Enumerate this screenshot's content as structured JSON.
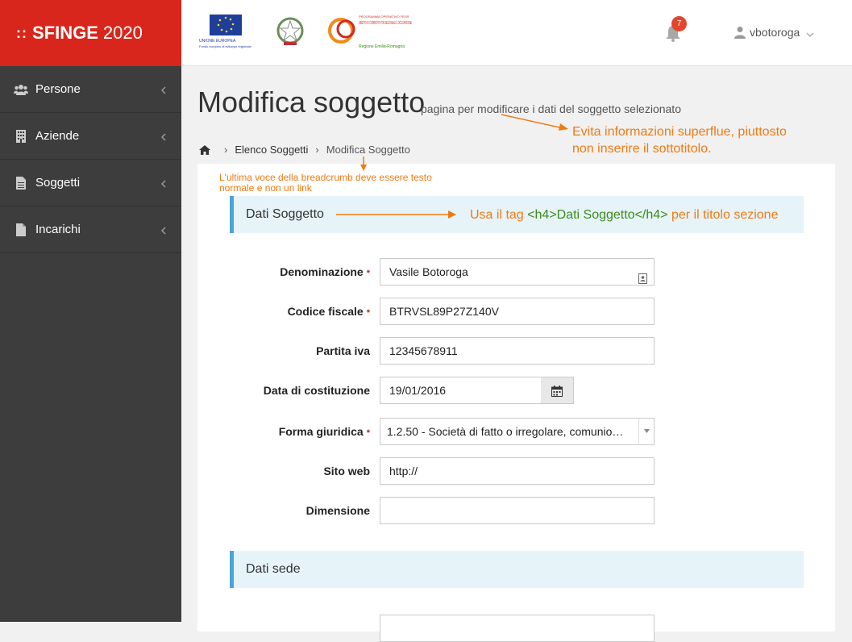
{
  "brand": {
    "prefix": "::",
    "name": "SFINGE",
    "year": "2020"
  },
  "logos": [
    {
      "icon": "eu-flag-logo",
      "lines": [
        "UNIONE EUROPEA",
        "Fondo europeo di sviluppo regionale"
      ]
    },
    {
      "icon": "italian-republic-emblem-logo"
    },
    {
      "icon": "por-logo",
      "lines": [
        "PROGRAMMA OPERATIVO FESR",
        "OBIETTIVO COMPETITIVITÀ REGIONALE E OCCUPAZIONE",
        "Regione Emilia-Romagna"
      ]
    }
  ],
  "header": {
    "notification_count": "7",
    "username": "vbotoroga"
  },
  "sidebar": {
    "items": [
      {
        "label": "Persone",
        "icon": "users-icon"
      },
      {
        "label": "Aziende",
        "icon": "building-icon"
      },
      {
        "label": "Soggetti",
        "icon": "document-icon"
      },
      {
        "label": "Incarichi",
        "icon": "document-outline-icon"
      }
    ]
  },
  "page": {
    "title": "Modifica soggetto",
    "subtitle": "pagina per modificare i dati del soggetto selezionato",
    "breadcrumb": [
      "Elenco Soggetti",
      "Modifica Soggetto"
    ]
  },
  "annotations": {
    "subtitle_note": [
      "Evita informazioni superflue, piuttosto",
      "non inserire il sottotitolo."
    ],
    "breadcrumb_note": [
      "L'ultima voce della breadcrumb deve essere testo",
      "normale e non un link"
    ],
    "section_note_pre": "Usa il tag ",
    "section_note_tag": "<h4>Dati Soggetto</h4>",
    "section_note_post": " per il titolo sezione"
  },
  "sections": [
    {
      "title": "Dati Soggetto"
    },
    {
      "title": "Dati sede"
    }
  ],
  "form": {
    "fields": [
      {
        "label": "Denominazione",
        "required": "*",
        "value": "Vasile Botoroga"
      },
      {
        "label": "Codice fiscale",
        "required": "*",
        "value": "BTRVSL89P27Z140V"
      },
      {
        "label": "Partita iva",
        "value": "12345678911"
      },
      {
        "label": "Data di costituzione",
        "value": "19/01/2016"
      },
      {
        "label": "Forma giuridica",
        "required": "*",
        "value": "1.2.50 - Società di fatto o irregolare, comunio…"
      },
      {
        "label": "Sito web",
        "value": "http://"
      },
      {
        "label": "Dimensione",
        "value": ""
      }
    ]
  },
  "colors": {
    "brand": "#d9261c",
    "sidebar": "#3d3d3d",
    "section_bg": "#e6f4fa",
    "section_border": "#45a6d8",
    "annotation": "#f07a12",
    "annotation_code": "#3d8a1a",
    "badge": "#e2462c"
  }
}
